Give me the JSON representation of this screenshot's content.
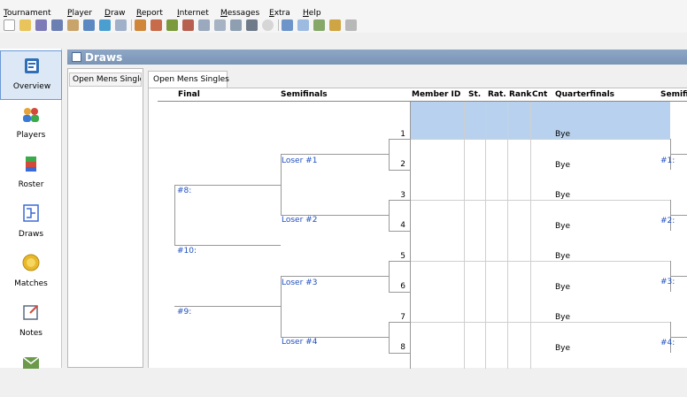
{
  "menu": [
    {
      "u": "T",
      "rest": "ournament"
    },
    {
      "u": "P",
      "rest": "layer"
    },
    {
      "u": "D",
      "rest": "raw"
    },
    {
      "u": "R",
      "rest": "eport"
    },
    {
      "u": "I",
      "rest": "nternet"
    },
    {
      "u": "M",
      "rest": "essages"
    },
    {
      "u": "E",
      "rest": "xtra"
    },
    {
      "u": "H",
      "rest": "elp"
    }
  ],
  "sidebar": {
    "items": [
      {
        "label": "Overview",
        "icon": "overview-icon",
        "active": true
      },
      {
        "label": "Players",
        "icon": "players-icon"
      },
      {
        "label": "Roster",
        "icon": "roster-icon"
      },
      {
        "label": "Draws",
        "icon": "draws-icon"
      },
      {
        "label": "Matches",
        "icon": "matches-icon"
      },
      {
        "label": "Notes",
        "icon": "notes-icon"
      }
    ]
  },
  "panel": {
    "title": "Draws"
  },
  "draw_list": [
    "Open Mens Singles"
  ],
  "tab": {
    "label": "Open Mens Singles"
  },
  "columns": {
    "final": "Final",
    "semifinals": "Semifinals",
    "member_id": "Member ID",
    "st": "St.",
    "rat": "Rat.",
    "rank": "Rank",
    "cnt": "Cnt",
    "quarterfinals": "Quarterfinals",
    "semifinals_right": "Semifi"
  },
  "positions": [
    "1",
    "2",
    "3",
    "4",
    "5",
    "6",
    "7",
    "8"
  ],
  "bye_label": "Bye",
  "final_labels": [
    "#8:",
    "#10:",
    "#9:"
  ],
  "semifinal_labels": [
    "Loser #1",
    "Loser #2",
    "Loser #3",
    "Loser #4"
  ],
  "right_semifinal_labels": [
    "#1:",
    "#2:",
    "#3:",
    "#4:"
  ]
}
